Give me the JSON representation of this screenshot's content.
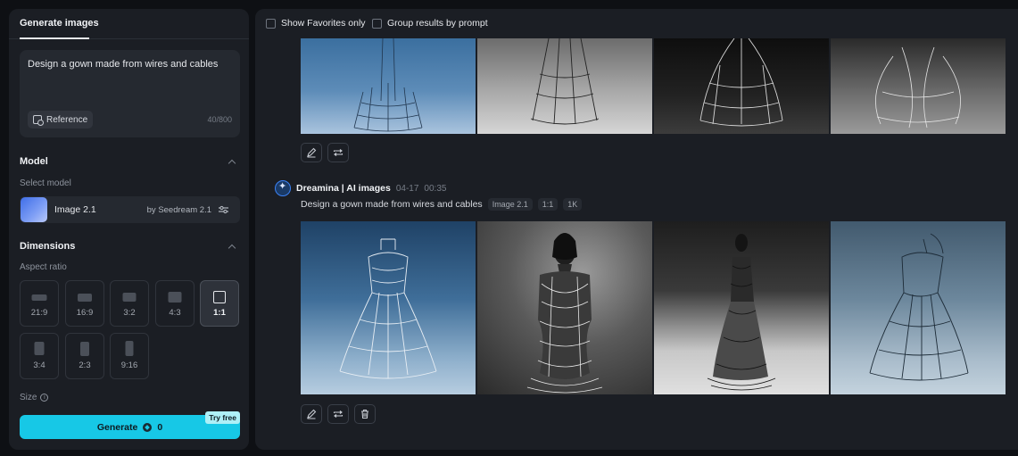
{
  "sidebar": {
    "tab": "Generate images",
    "prompt": "Design a gown made from wires and cables",
    "reference_label": "Reference",
    "char_count": "40/800",
    "model_section": "Model",
    "select_model_label": "Select model",
    "model_name": "Image 2.1",
    "model_by": "by Seedream 2.1",
    "dimensions_section": "Dimensions",
    "aspect_ratio_label": "Aspect ratio",
    "aspect_ratios": [
      "21:9",
      "16:9",
      "3:2",
      "4:3",
      "1:1",
      "3:4",
      "2:3",
      "9:16"
    ],
    "selected_ratio": "1:1",
    "size_label": "Size",
    "generate_label": "Generate",
    "generate_cost": "0",
    "try_free": "Try free",
    "accent": "#17c8e6"
  },
  "results": {
    "filter_favorites": "Show Favorites only",
    "filter_group": "Group results by prompt",
    "author": "Dreamina | AI images",
    "date": "04-17",
    "time": "00:35",
    "prompt": "Design a gown made from wires and cables",
    "tags": [
      "Image 2.1",
      "1:1",
      "1K"
    ]
  }
}
